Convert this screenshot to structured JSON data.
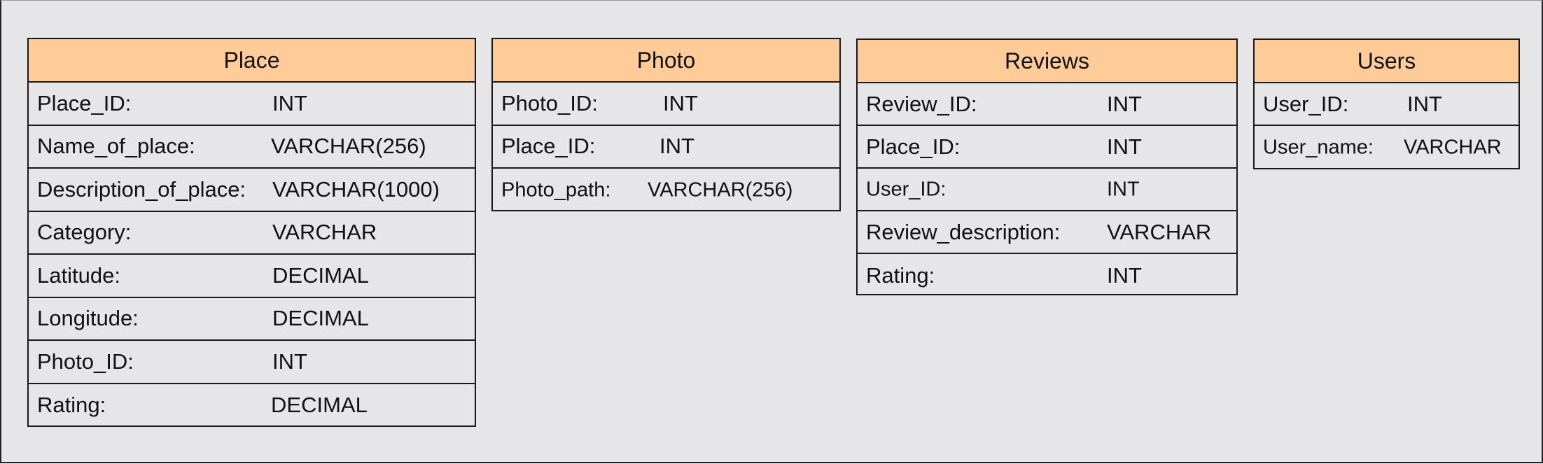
{
  "entities": {
    "place": {
      "title": "Place",
      "fields": [
        {
          "name": "Place_ID:",
          "type": "INT"
        },
        {
          "name": "Name_of_place:",
          "type": "VARCHAR(256)"
        },
        {
          "name": "Description_of_place:",
          "type": "VARCHAR(1000)"
        },
        {
          "name": "Category:",
          "type": "VARCHAR"
        },
        {
          "name": "Latitude:",
          "type": "DECIMAL"
        },
        {
          "name": "Longitude:",
          "type": "DECIMAL"
        },
        {
          "name": "Photo_ID:",
          "type": "INT"
        },
        {
          "name": "Rating:",
          "type": "DECIMAL"
        }
      ]
    },
    "photo": {
      "title": "Photo",
      "fields": [
        {
          "name": "Photo_ID:",
          "type": "INT"
        },
        {
          "name": "Place_ID:",
          "type": "INT"
        },
        {
          "name": "Photo_path:",
          "type": "VARCHAR(256)"
        }
      ]
    },
    "reviews": {
      "title": "Reviews",
      "fields": [
        {
          "name": "Review_ID:",
          "type": "INT"
        },
        {
          "name": "Place_ID:",
          "type": "INT"
        },
        {
          "name": "User_ID:",
          "type": "INT"
        },
        {
          "name": "Review_description:",
          "type": "VARCHAR"
        },
        {
          "name": "Rating:",
          "type": "INT"
        }
      ]
    },
    "users": {
      "title": "Users",
      "fields": [
        {
          "name": "User_ID:",
          "type": "INT"
        },
        {
          "name": "User_name:",
          "type": "VARCHAR"
        }
      ]
    }
  },
  "colors": {
    "header_fill": "#ffcc99",
    "canvas_background": "#e6e6e8",
    "border": "#1a1a1a"
  }
}
